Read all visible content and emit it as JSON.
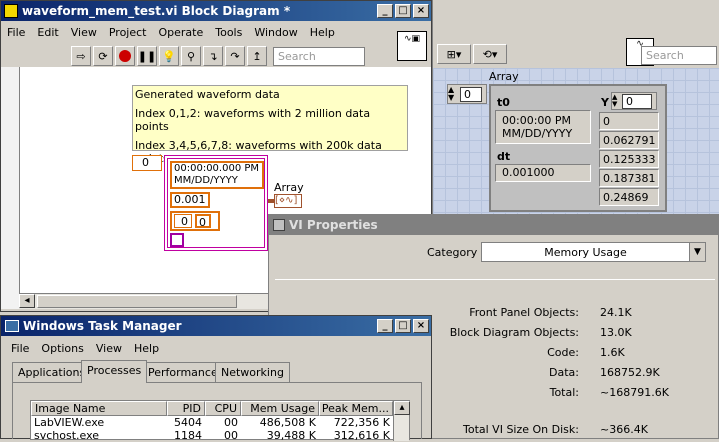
{
  "block_diagram": {
    "title": "waveform_mem_test.vi Block Diagram *",
    "menu": [
      "File",
      "Edit",
      "View",
      "Project",
      "Operate",
      "Tools",
      "Window",
      "Help"
    ],
    "search_placeholder": "Search",
    "comment": {
      "line1": "Generated waveform data",
      "line2": "Index 0,1,2: waveforms with 2 million data points",
      "line3": "Index 3,4,5,6,7,8: waveforms with 200k data points"
    },
    "index_const": "0",
    "timestamp": "00:00:00.000 PM",
    "date_fmt": "MM/DD/YYYY",
    "dt_const": "0.001",
    "y_index": "0",
    "y_value": "0",
    "array_label": "Array",
    "array_terminal": "[⋄∿]"
  },
  "front_panel": {
    "search_placeholder": "Search",
    "array_label": "Array",
    "index": "0",
    "t0_label": "t0",
    "t0_time": "00:00:00 PM",
    "t0_date": "MM/DD/YYYY",
    "dt_label": "dt",
    "dt_value": "0.001000",
    "y_label": "Y",
    "y_index": "0",
    "y_values": [
      "0",
      "0.062791",
      "0.125333",
      "0.187381",
      "0.24869"
    ]
  },
  "vi_properties": {
    "title": "VI Properties",
    "category_label": "Category",
    "category_value": "Memory Usage",
    "rows": [
      {
        "label": "Front Panel Objects:",
        "value": "24.1K"
      },
      {
        "label": "Block Diagram Objects:",
        "value": "13.0K"
      },
      {
        "label": "Code:",
        "value": "1.6K"
      },
      {
        "label": "Data:",
        "value": "168752.9K"
      },
      {
        "label": "Total:",
        "value": "~168791.6K"
      }
    ],
    "disk_label": "Total VI Size On Disk:",
    "disk_value": "~366.4K"
  },
  "task_manager": {
    "title": "Windows Task Manager",
    "menu": [
      "File",
      "Options",
      "View",
      "Help"
    ],
    "tabs": [
      "Applications",
      "Processes",
      "Performance",
      "Networking"
    ],
    "columns": [
      "Image Name",
      "PID",
      "CPU",
      "Mem Usage",
      "Peak Mem..."
    ],
    "rows": [
      {
        "name": "LabVIEW.exe",
        "pid": "5404",
        "cpu": "00",
        "mem": "486,508 K",
        "peak": "722,356 K"
      },
      {
        "name": "svchost.exe",
        "pid": "1184",
        "cpu": "00",
        "mem": "39,488 K",
        "peak": "312,616 K"
      }
    ]
  }
}
